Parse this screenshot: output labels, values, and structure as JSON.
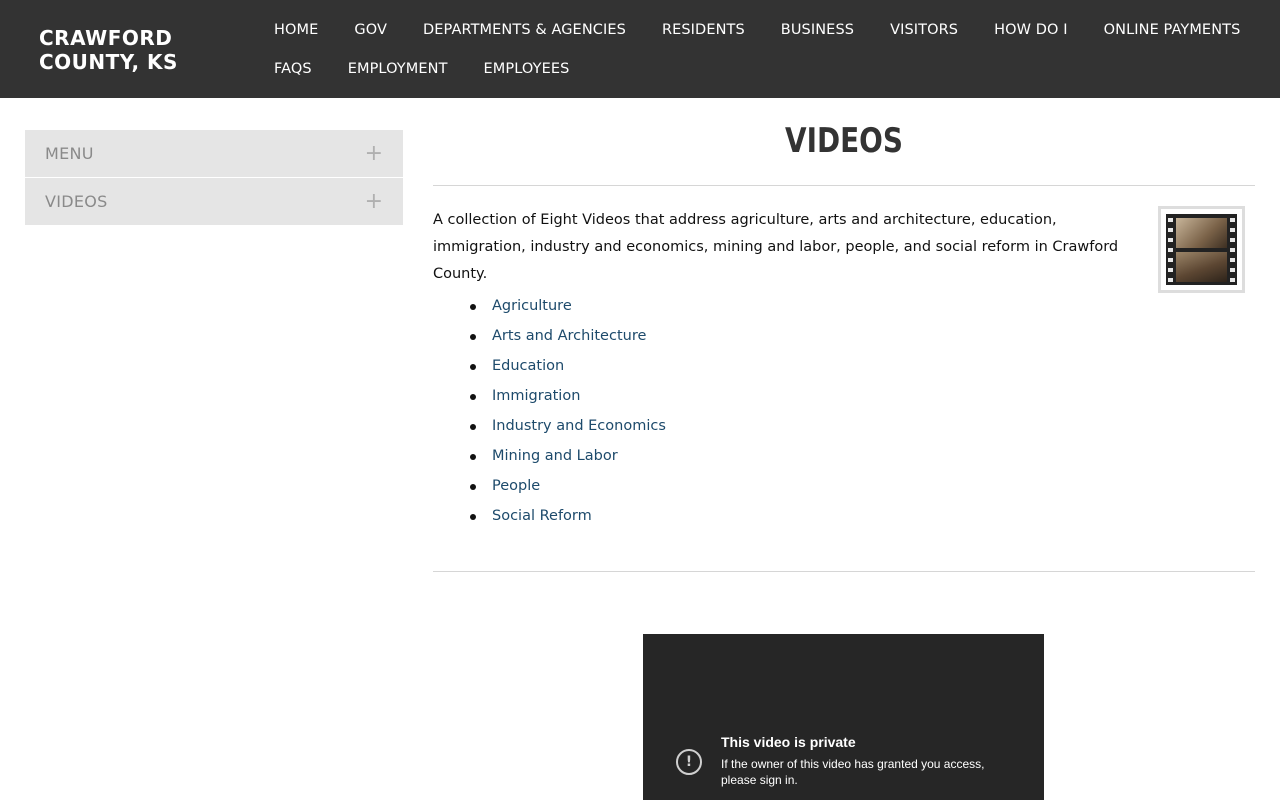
{
  "header": {
    "site_title": "Crawford County, KS",
    "nav_row1": [
      "Home",
      "Gov",
      "Departments & Agencies",
      "Residents",
      "Business",
      "Visitors",
      "How Do I",
      "Online Payments"
    ],
    "nav_row2": [
      "FAQs",
      "Employment",
      "Employees"
    ]
  },
  "sidebar": {
    "items": [
      {
        "label": "Menu",
        "icon": "plus-icon",
        "symbol": "+"
      },
      {
        "label": "Videos",
        "icon": "plus-icon",
        "symbol": "+"
      }
    ]
  },
  "main": {
    "title": "Videos",
    "intro": "A collection of Eight Videos that address agriculture, arts and architecture, education, immigration, industry and economics, mining and labor, people, and social reform in Crawford County.",
    "thumbnail_icon": "film-strip-icon",
    "links": [
      "Agriculture",
      "Arts and Architecture",
      "Education",
      "Immigration",
      "Industry and Economics",
      "Mining and Labor",
      "People",
      "Social Reform"
    ]
  },
  "video": {
    "icon": "alert-circle-icon",
    "icon_symbol": "!",
    "title": "This video is private",
    "message": "If the owner of this video has granted you access, please sign in."
  },
  "colors": {
    "header_bg": "#333333",
    "sidebar_bg": "#e5e5e5",
    "link": "#1d4a6b",
    "video_bg": "#262626"
  }
}
